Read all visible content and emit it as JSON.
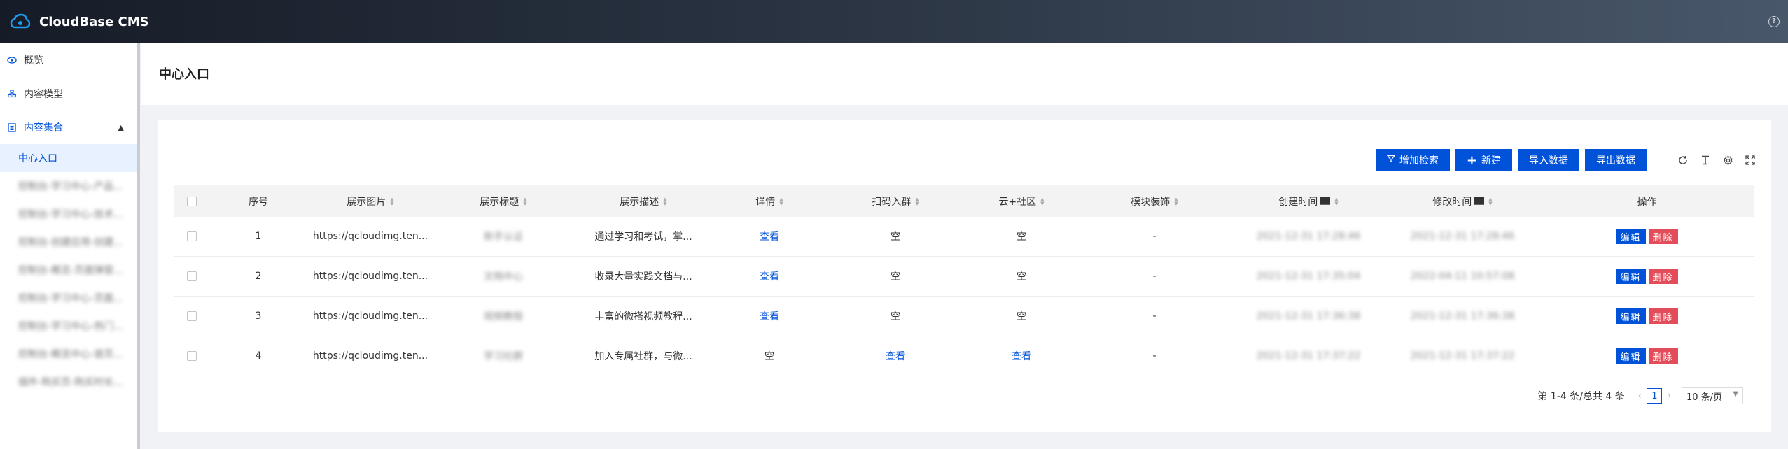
{
  "header": {
    "brand": "CloudBase CMS",
    "help_icon": "help-circle-icon"
  },
  "sidebar": {
    "items": [
      {
        "label": "概览",
        "icon": "eye-icon"
      },
      {
        "label": "内容模型",
        "icon": "model-icon"
      },
      {
        "label": "内容集合",
        "icon": "collection-icon"
      }
    ],
    "selected_sub": "中心入口",
    "blurred_subs": [
      "控制台-学习中心-产品...",
      "控制台-学习中心-技术...",
      "控制台-创建应用-创建...",
      "控制台-概览-页面弹窗...",
      "控制台-学习中心-页面...",
      "控制台-学习中心-热门...",
      "控制台-概览中心-首页...",
      "插件-购买页-购买时长..."
    ]
  },
  "page": {
    "title": "中心入口"
  },
  "toolbar": {
    "add_filter": "增加检索",
    "new": "新建",
    "import": "导入数据",
    "export": "导出数据"
  },
  "table": {
    "headers": {
      "index": "序号",
      "image": "展示图片",
      "title": "展示标题",
      "desc": "展示描述",
      "detail": "详情",
      "scan": "扫码入群",
      "cloud": "云+社区",
      "module": "模块装饰",
      "created": "创建时间",
      "modified": "修改时间",
      "op": "操作"
    },
    "rows": [
      {
        "index": "1",
        "image": "https://qcloudimg.ten...",
        "title": "新手认证",
        "desc": "通过学习和考试，掌...",
        "detail": "查看",
        "scan": "空",
        "cloud": "空",
        "module": "-",
        "created": "2021-12-31 17:28:46",
        "modified": "2021-12-31 17:28:46"
      },
      {
        "index": "2",
        "image": "https://qcloudimg.ten...",
        "title": "文档中心",
        "desc": "收录大量实践文档与...",
        "detail": "查看",
        "scan": "空",
        "cloud": "空",
        "module": "-",
        "created": "2021-12-31 17:35:04",
        "modified": "2022-04-11 10:57:08"
      },
      {
        "index": "3",
        "image": "https://qcloudimg.ten...",
        "title": "视频教程",
        "desc": "丰富的微搭视频教程...",
        "detail": "查看",
        "scan": "空",
        "cloud": "空",
        "module": "-",
        "created": "2021-12-31 17:36:38",
        "modified": "2021-12-31 17:36:38"
      },
      {
        "index": "4",
        "image": "https://qcloudimg.ten...",
        "title": "学习社群",
        "desc": "加入专属社群，与微...",
        "detail": "空",
        "scan": "查看",
        "cloud": "查看",
        "module": "-",
        "created": "2021-12-31 17:37:22",
        "modified": "2021-12-31 17:37:22"
      }
    ],
    "edit_label": "编辑",
    "delete_label": "删除"
  },
  "pagination": {
    "summary": "第 1-4 条/总共 4 条",
    "current": "1",
    "page_size": "10 条/页"
  },
  "colors": {
    "primary": "#0052d9",
    "danger": "#e34d59"
  }
}
